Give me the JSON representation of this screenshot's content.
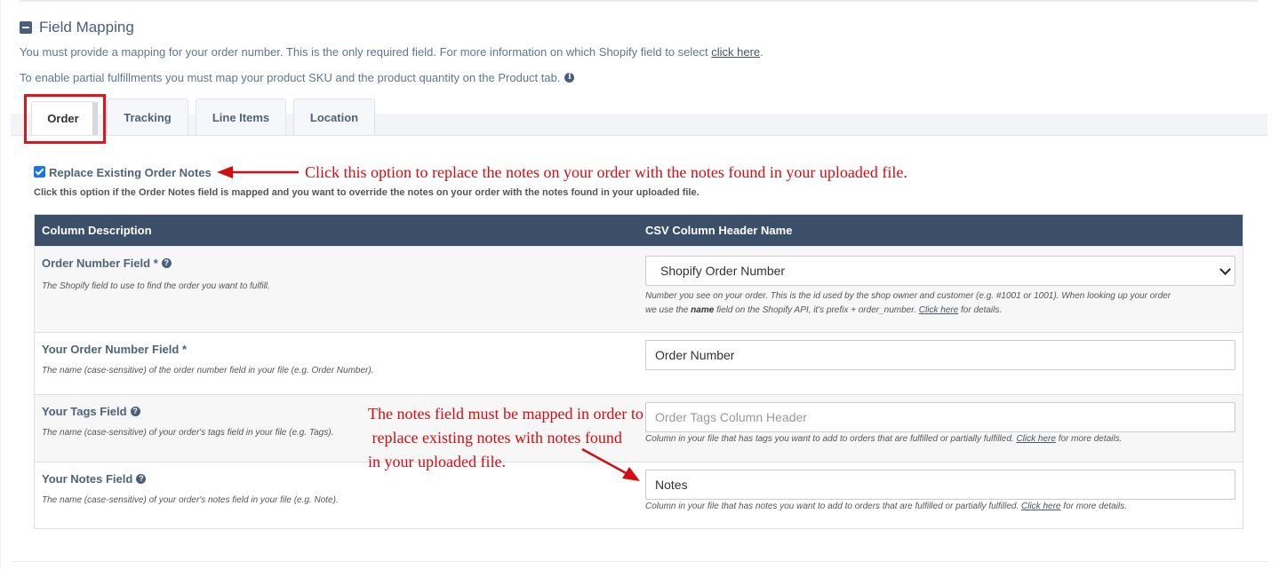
{
  "section": {
    "title": "Field Mapping",
    "intro_line1": "You must provide a mapping for your order number. This is the only required field. For more information on which Shopify field to select",
    "intro_link": "click here",
    "intro_line2": "To enable partial fulfillments you must map your product SKU and the product quantity on the Product tab."
  },
  "tabs": [
    {
      "label": "Order",
      "active": true
    },
    {
      "label": "Tracking",
      "active": false
    },
    {
      "label": "Line Items",
      "active": false
    },
    {
      "label": "Location",
      "active": false
    }
  ],
  "replace_notes": {
    "checked": true,
    "label": "Replace Existing Order Notes",
    "help": "Click this option if the Order Notes field is mapped and you want to override the notes on your order with the notes found in your uploaded file."
  },
  "annotations": {
    "top": "Click this option to replace the notes on your order with the notes found in your uploaded file.",
    "middle_line1": "The notes field must be mapped in order to",
    "middle_line2": " replace existing notes with notes found",
    "middle_line3": "in your uploaded file.",
    "color": "#d40d12"
  },
  "table": {
    "col1": "Column Description",
    "col2": "CSV Column Header Name",
    "rows": [
      {
        "label": "Order Number Field *",
        "desc": "The Shopify field to use to find the order you want to fulfill.",
        "select_value": "Shopify Order Number",
        "help_pre": "Number you see on your order. This is the id used by the shop owner and customer (e.g. #1001 or 1001). When looking up your order",
        "help_mid_pre": "we use the",
        "help_bold": "name",
        "help_mid_post": "field on the Shopify API, it's prefix + order_number.",
        "help_link": "Click here",
        "help_post": "for details."
      },
      {
        "label": "Your Order Number Field *",
        "desc": "The name (case-sensitive) of the order number field in your file (e.g. Order Number).",
        "value": "Order Number"
      },
      {
        "label": "Your Tags Field",
        "desc": "The name (case-sensitive) of your order's tags field in your file (e.g. Tags).",
        "placeholder": "Order Tags Column Header",
        "help_pre": "Column in your file that has tags you want to add to orders that are fulfilled or partially fulfilled.",
        "help_link": "Click here",
        "help_post": "for more details."
      },
      {
        "label": "Your Notes Field",
        "desc": "The name (case-sensitive) of your order's notes field in your file (e.g. Note).",
        "value": "Notes",
        "help_pre": "Column in your file that has notes you want to add to orders that are fulfilled or partially fulfilled.",
        "help_link": "Click here",
        "help_post": "for more details."
      }
    ]
  },
  "colors": {
    "header_bg": "#3b5068",
    "accent_text": "#4d6478",
    "highlight_border": "#e0141b"
  }
}
